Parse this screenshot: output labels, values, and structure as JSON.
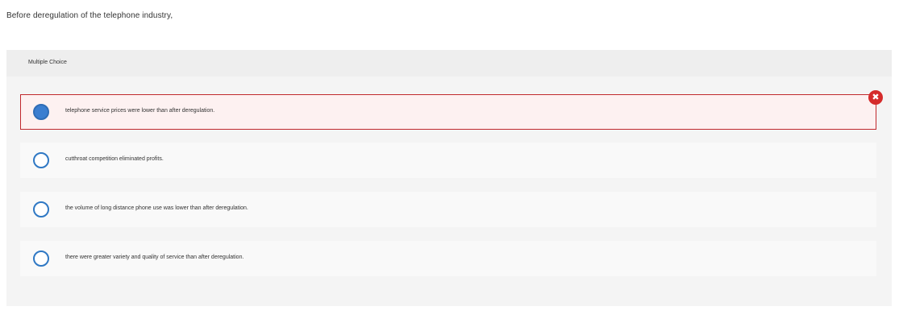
{
  "question": {
    "prompt": "Before deregulation of the telephone industry,"
  },
  "panel": {
    "type_label": "Multiple Choice"
  },
  "choices": [
    {
      "label": "telephone service prices were lower than after deregulation.",
      "selected": true,
      "state": "incorrect"
    },
    {
      "label": "cutthroat competition eliminated profits.",
      "selected": false
    },
    {
      "label": "the volume of long distance phone use was lower than after deregulation.",
      "selected": false
    },
    {
      "label": "there were greater variety and quality of service than after deregulation.",
      "selected": false
    }
  ],
  "feedback": {
    "icon": "incorrect-x-icon",
    "glyph": "✖",
    "color": "#d52b2b"
  },
  "colors": {
    "radio_accent": "#2f78c4",
    "incorrect_border": "#c0282d"
  }
}
